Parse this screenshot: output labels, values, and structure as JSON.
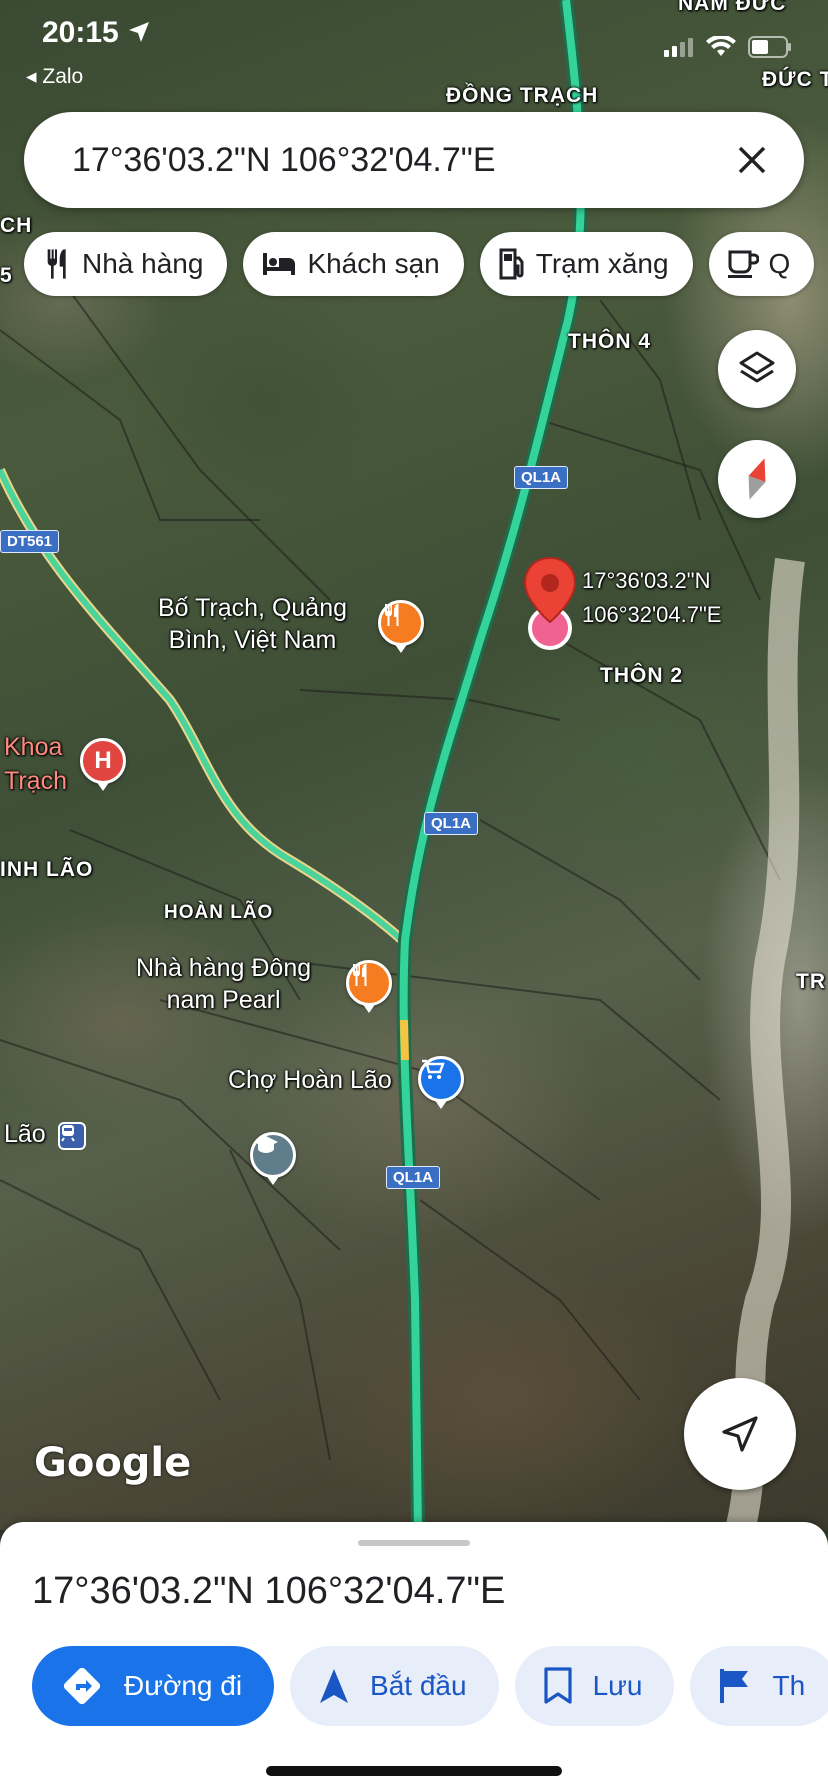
{
  "status_bar": {
    "time": "20:15",
    "back_app": "◂ Zalo"
  },
  "search": {
    "query": "17°36'03.2\"N 106°32'04.7\"E"
  },
  "chips": [
    {
      "label": "Nhà hàng",
      "icon": "restaurant-icon"
    },
    {
      "label": "Khách sạn",
      "icon": "hotel-icon"
    },
    {
      "label": "Trạm xăng",
      "icon": "gas-station-icon"
    },
    {
      "label": "Q",
      "icon": "coffee-icon"
    }
  ],
  "map": {
    "labels": {
      "nam_duc": "NAM ĐỨC",
      "duc_t": "ĐỨC T",
      "dong_trach": "ĐỒNG TRẠCH",
      "thon4": "THÔN 4",
      "thon2": "THÔN 2",
      "hoan_lao": "HOÀN LÃO",
      "minh_lao": "INH LÃO",
      "tr": "TR",
      "ch": "CH",
      "lao": "Lão",
      "five": "5",
      "bo_trach_1": "Bố Trạch, Quảng",
      "bo_trach_2": "Bình, Việt Nam",
      "khoa_1": "Khoa",
      "khoa_2": "Trạch",
      "nh_dong_1": "Nhà hàng Đông",
      "nh_dong_2": "nam Pearl",
      "cho": "Chợ Hoàn Lão",
      "pin_lat": "17°36'03.2\"N",
      "pin_lng": "106°32'04.7\"E"
    },
    "shields": {
      "ql1a": "QL1A",
      "dt561": "DT561"
    },
    "google_logo": "Google"
  },
  "sheet": {
    "title": "17°36'03.2\"N 106°32'04.7\"E",
    "actions": [
      {
        "label": "Đường đi",
        "icon": "directions-icon"
      },
      {
        "label": "Bắt đầu",
        "icon": "navigation-arrow-icon"
      },
      {
        "label": "Lưu",
        "icon": "bookmark-icon"
      },
      {
        "label": "Th",
        "icon": "flag-icon"
      }
    ]
  },
  "colors": {
    "accent_blue": "#1a73e8",
    "traffic_green": "#34d399",
    "pin_red": "#ea4335"
  }
}
